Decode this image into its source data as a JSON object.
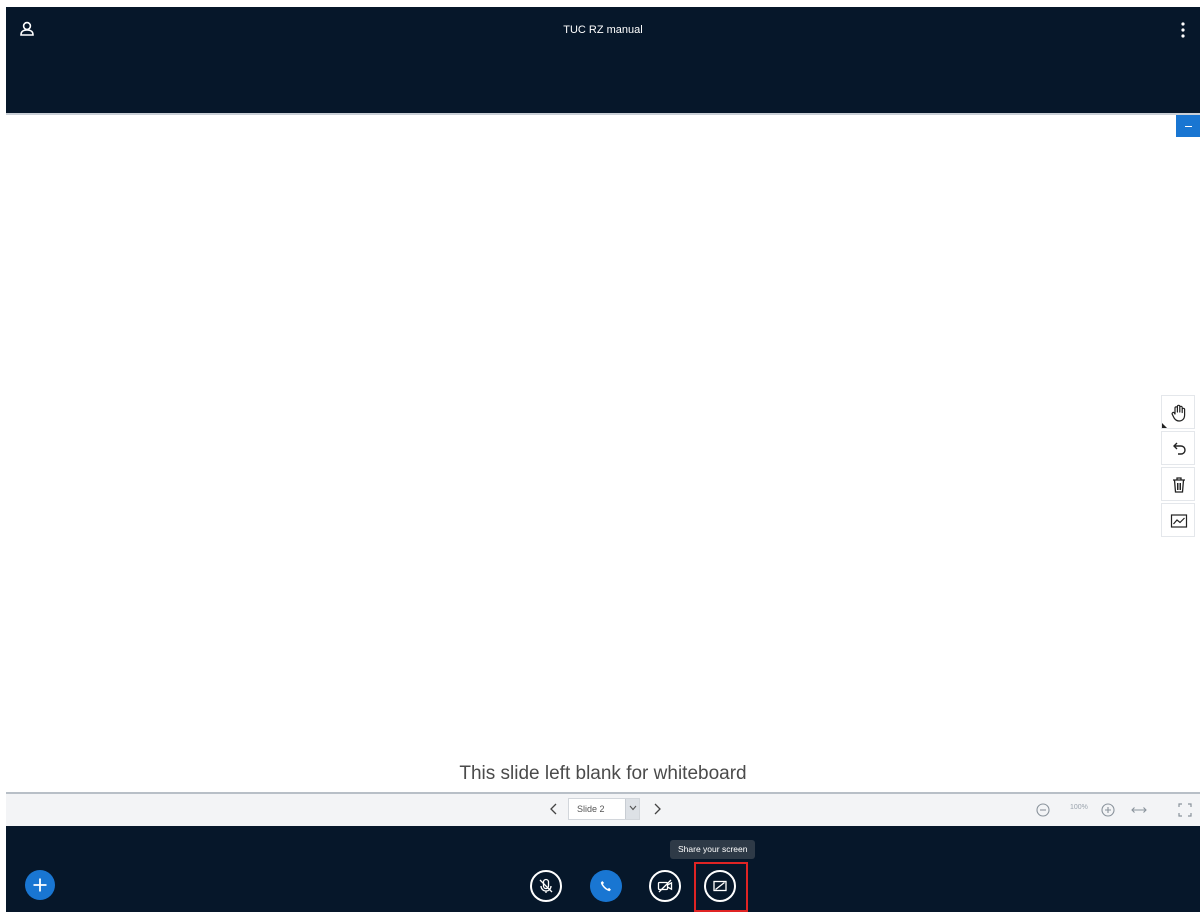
{
  "header": {
    "title": "TUC RZ manual",
    "user_icon": "user-icon",
    "more_icon": "more-vertical-icon"
  },
  "presentation": {
    "slide_text": "This slide left blank for whiteboard",
    "minimize_icon": "minimize-icon",
    "whiteboard_tools": [
      {
        "name": "hand-tool",
        "icon": "hand-icon"
      },
      {
        "name": "undo-tool",
        "icon": "undo-icon"
      },
      {
        "name": "clear-tool",
        "icon": "trash-icon"
      },
      {
        "name": "multi-user-tool",
        "icon": "chart-line-icon"
      }
    ]
  },
  "slide_controls": {
    "slide_label": "Slide 2",
    "zoom_label": "100%"
  },
  "action_bar": {
    "tooltip": "Share your screen",
    "buttons": [
      "actions",
      "mute-microphone",
      "leave-audio",
      "share-webcam",
      "share-screen"
    ]
  },
  "colors": {
    "header_bg": "#06172a",
    "accent": "#1976d2",
    "highlight": "#e02424"
  }
}
